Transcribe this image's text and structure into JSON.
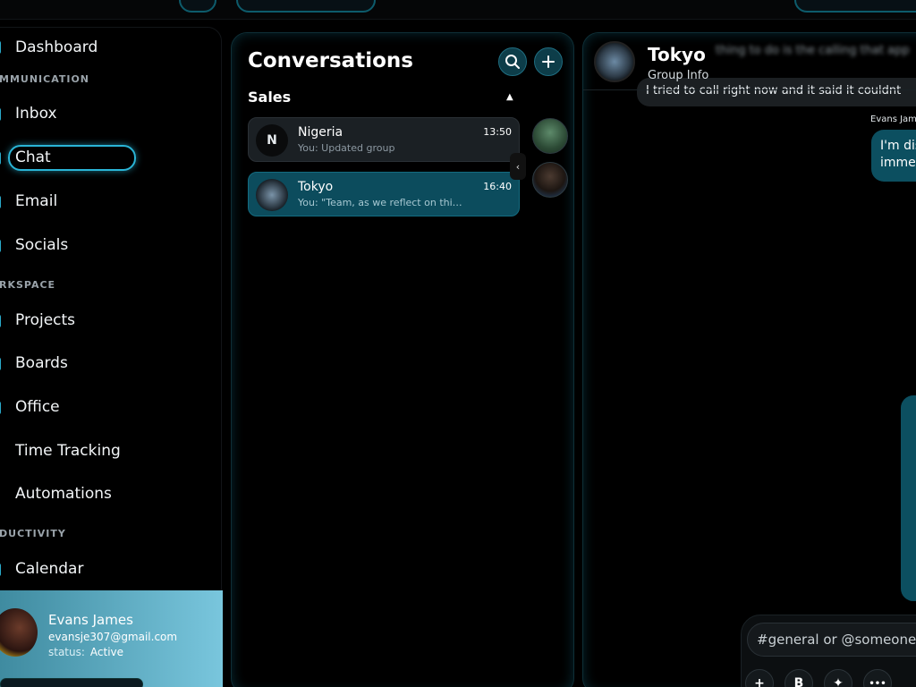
{
  "sidebar": {
    "items": [
      {
        "label": "Dashboard"
      },
      {
        "label": "Inbox"
      },
      {
        "label": "Chat"
      },
      {
        "label": "Email"
      },
      {
        "label": "Socials"
      },
      {
        "label": "Projects"
      },
      {
        "label": "Boards"
      },
      {
        "label": "Office"
      },
      {
        "label": "Time Tracking"
      },
      {
        "label": "Automations"
      },
      {
        "label": "Calendar"
      }
    ],
    "sections": [
      "MMUNICATION",
      "RKSPACE",
      "DUCTIVITY"
    ],
    "active_item": "Chat"
  },
  "profile": {
    "name": "Evans James",
    "email": "evansje307@gmail.com",
    "status_label": "status:",
    "status_value": "Active"
  },
  "conversations": {
    "title": "Conversations",
    "group": "Sales",
    "items": [
      {
        "initial": "N",
        "name": "Nigeria",
        "preview": "You: Updated group",
        "time": "13:50",
        "active": false
      },
      {
        "initial": "",
        "name": "Tokyo",
        "preview": "You: \"Team, as we reflect on this past year",
        "time": "16:40",
        "active": true
      }
    ],
    "icons": {
      "search": "search-icon",
      "add": "plus-icon",
      "collapse": "chevron-left-icon"
    }
  },
  "chat": {
    "title": "Tokyo",
    "subtitle": "Group Info",
    "blurred_message": "thing to do is the calling that app",
    "top_message": "I tried to call right now and it said it couldnt",
    "sender": "Evans Jam",
    "outgoing_message_line1": "I'm dis",
    "outgoing_message_line2": "immed",
    "composer_placeholder": "#general or @someone...",
    "tools": {
      "add": "+",
      "bold": "B",
      "ai": "✦",
      "more": "•••"
    }
  },
  "colors": {
    "accent": "#2ab4d6",
    "active_bubble": "#0c4f60",
    "panel_bg": "#000000"
  }
}
